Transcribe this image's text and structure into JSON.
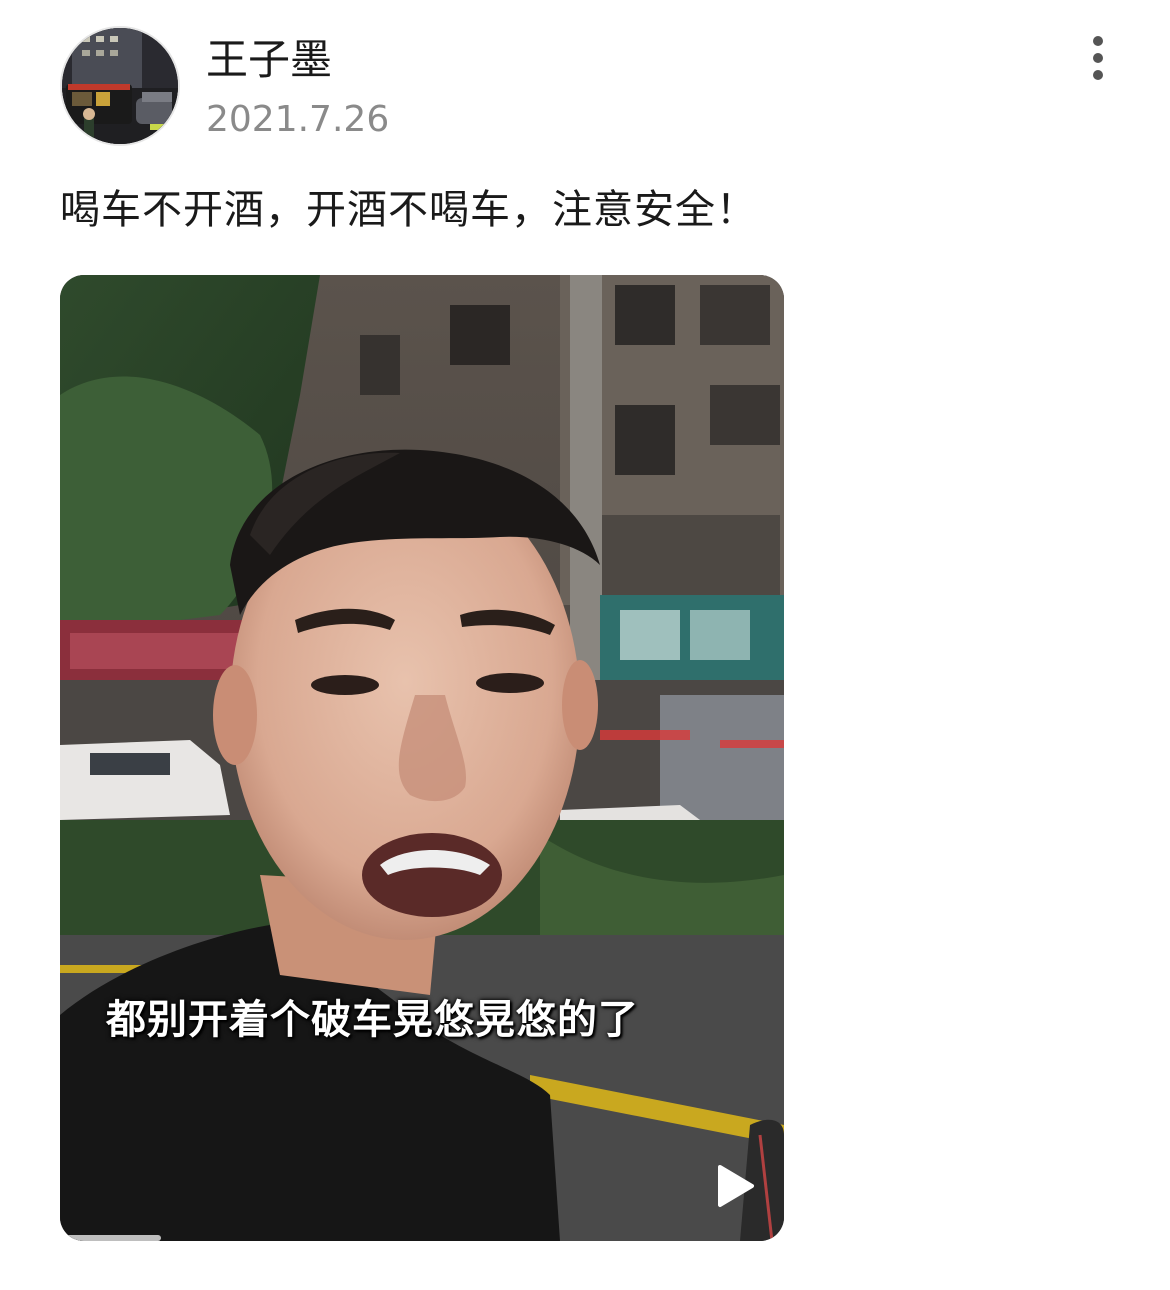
{
  "post": {
    "author": {
      "name": "王子墨",
      "avatar_icon": "user-avatar"
    },
    "date": "2021.7.26",
    "text": "喝车不开酒，开酒不喝车，注意安全！",
    "more_icon": "more-vertical-icon"
  },
  "video": {
    "subtitle": "都别开着个破车晃悠晃悠的了",
    "play_icon": "play-icon",
    "progress": 0.14
  }
}
